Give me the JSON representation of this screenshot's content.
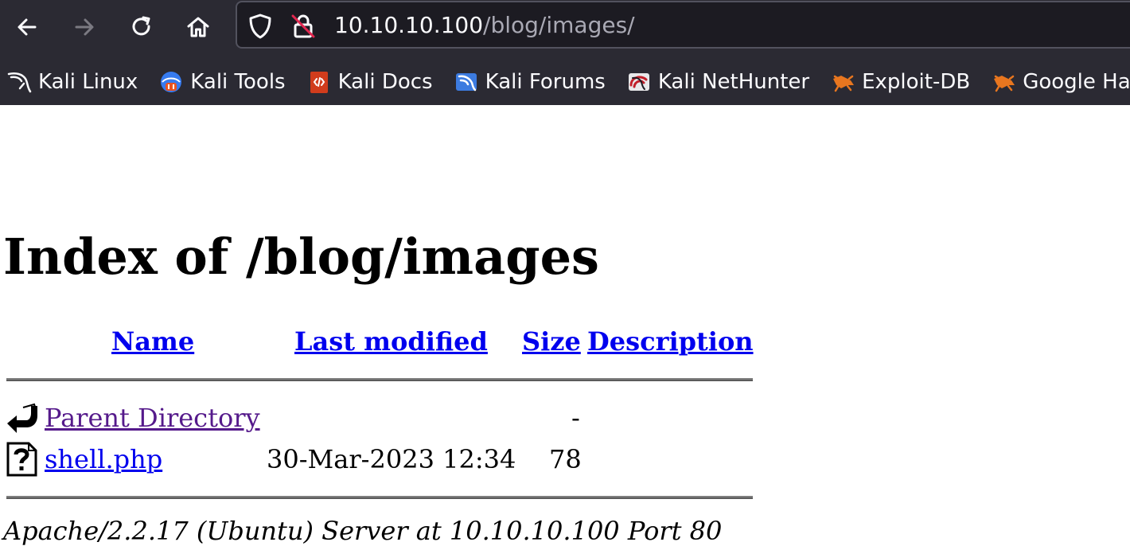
{
  "browser": {
    "url_host": "10.10.10.100",
    "url_path": "/blog/images/",
    "bookmarks": [
      {
        "label": "Kali Linux",
        "icon": "kali-dragon-icon"
      },
      {
        "label": "Kali Tools",
        "icon": "kali-tools-icon"
      },
      {
        "label": "Kali Docs",
        "icon": "kali-docs-icon"
      },
      {
        "label": "Kali Forums",
        "icon": "kali-forums-icon"
      },
      {
        "label": "Kali NetHunter",
        "icon": "kali-nethunter-icon"
      },
      {
        "label": "Exploit-DB",
        "icon": "exploit-db-icon"
      },
      {
        "label": "Google Ha",
        "icon": "google-hacking-icon"
      }
    ]
  },
  "page": {
    "title": "Index of /blog/images",
    "headers": {
      "name": "Name",
      "last_modified": "Last modified",
      "size": "Size",
      "description": "Description"
    },
    "rows": [
      {
        "name": "Parent Directory",
        "last_modified": "",
        "size": "-",
        "description": "",
        "icon": "back-arrow-icon",
        "visited": true
      },
      {
        "name": "shell.php",
        "last_modified": "30-Mar-2023 12:34",
        "size": "78",
        "description": "",
        "icon": "unknown-file-icon",
        "visited": false
      }
    ],
    "footer": "Apache/2.2.17 (Ubuntu) Server at 10.10.10.100 Port 80"
  },
  "colors": {
    "chrome_bg": "#2b2a33",
    "urlbar_bg": "#1c1b22",
    "link": "#0000ee",
    "visited_link": "#551a8b"
  }
}
